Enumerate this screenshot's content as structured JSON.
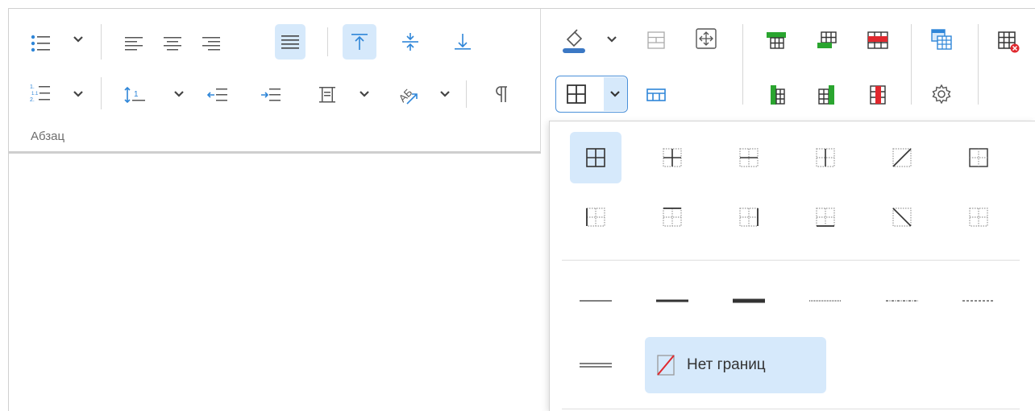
{
  "group": {
    "label": "Абзац"
  },
  "colors": {
    "accent": "#2f86d8",
    "active_bg": "#d6e9fb",
    "green": "#2aa52f",
    "red": "#e0282e"
  },
  "borders_menu": {
    "presets": [
      "all-borders",
      "inside-borders",
      "inside-horizontal-borders",
      "inside-vertical-borders",
      "diagonal-up-border",
      "inside-cross-border",
      "left-border",
      "top-border",
      "right-border",
      "bottom-border",
      "diagonal-down-border",
      "no-border-preset"
    ],
    "line_styles": [
      "thin",
      "medium",
      "thick",
      "dotted",
      "dash-dot",
      "dashed",
      "double"
    ],
    "no_borders_label": "Нет границ"
  }
}
